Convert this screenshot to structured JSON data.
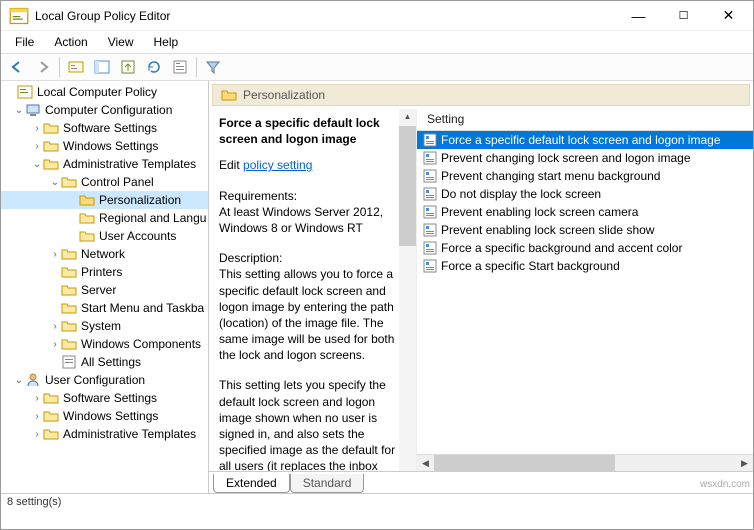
{
  "window": {
    "title": "Local Group Policy Editor"
  },
  "menu": {
    "file": "File",
    "action": "Action",
    "view": "View",
    "help": "Help"
  },
  "tree": {
    "root": "Local Computer Policy",
    "cc": "Computer Configuration",
    "ss": "Software Settings",
    "ws": "Windows Settings",
    "at": "Administrative Templates",
    "cp": "Control Panel",
    "pers": "Personalization",
    "reg": "Regional and Langu",
    "ua": "User Accounts",
    "net": "Network",
    "prn": "Printers",
    "srv": "Server",
    "smt": "Start Menu and Taskba",
    "sys": "System",
    "wcomp": "Windows Components",
    "alls": "All Settings",
    "uc": "User Configuration",
    "ss2": "Software Settings",
    "ws2": "Windows Settings",
    "at2": "Administrative Templates"
  },
  "category": {
    "title": "Personalization"
  },
  "detail": {
    "heading": "Force a specific default lock screen and logon image",
    "edit_prefix": "Edit ",
    "edit_link": "policy setting ",
    "req_lbl": "Requirements:",
    "req_txt": "At least Windows Server 2012, Windows 8 or Windows RT",
    "desc_lbl": "Description:",
    "desc_p1": "This setting allows you to force a specific default lock screen and logon image by entering the path (location) of the image file. The same image will be used for both the lock and logon screens.",
    "desc_p2": "This setting lets you specify the default lock screen and logon image shown when no user is signed in, and also sets the specified image as the default for all users (it replaces the inbox default image)."
  },
  "list": {
    "column": "Setting",
    "items": [
      "Force a specific default lock screen and logon image",
      "Prevent changing lock screen and logon image",
      "Prevent changing start menu background",
      "Do not display the lock screen",
      "Prevent enabling lock screen camera",
      "Prevent enabling lock screen slide show",
      "Force a specific background and accent color",
      "Force a specific Start background"
    ]
  },
  "tabs": {
    "extended": "Extended",
    "standard": "Standard"
  },
  "status": {
    "text": "8 setting(s)"
  },
  "watermark": "wsxdn.com"
}
